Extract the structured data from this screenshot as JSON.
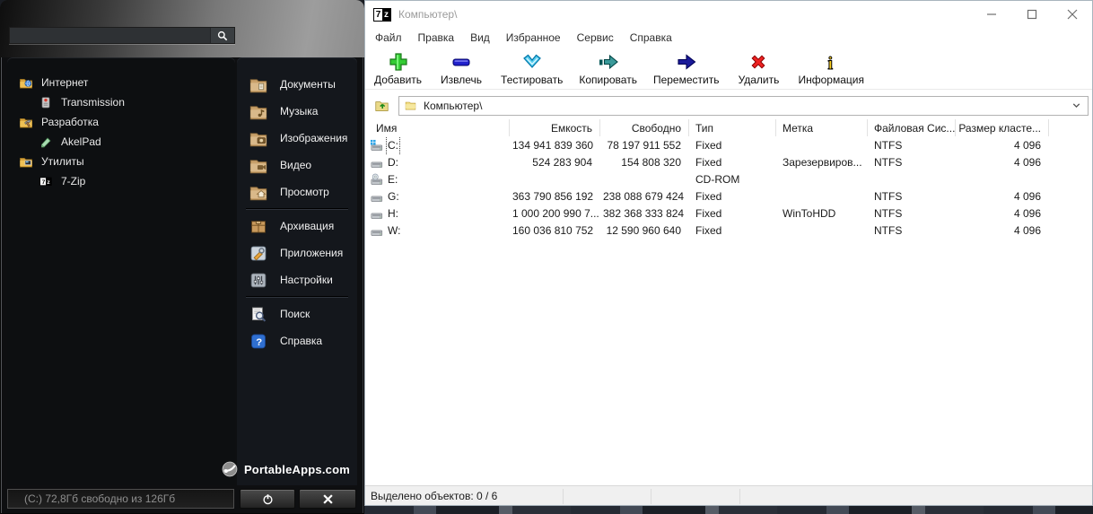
{
  "portableapps": {
    "search": {
      "value": "",
      "placeholder": ""
    },
    "left_items": [
      {
        "label": "Интернет",
        "type": "category",
        "icon": "folder-globe-icon"
      },
      {
        "label": "Transmission",
        "type": "app",
        "icon": "transmission-icon"
      },
      {
        "label": "Разработка",
        "type": "category",
        "icon": "folder-dev-icon"
      },
      {
        "label": "AkelPad",
        "type": "app",
        "icon": "akelpad-icon"
      },
      {
        "label": "Утилиты",
        "type": "category",
        "icon": "folder-utils-icon"
      },
      {
        "label": "7-Zip",
        "type": "app",
        "icon": "sevenzip-app-icon"
      }
    ],
    "right_items": [
      {
        "label": "Документы",
        "icon": "folder-documents-icon"
      },
      {
        "label": "Музыка",
        "icon": "folder-music-icon"
      },
      {
        "label": "Изображения",
        "icon": "folder-pictures-icon"
      },
      {
        "label": "Видео",
        "icon": "folder-video-icon"
      },
      {
        "label": "Просмотр",
        "icon": "folder-explore-icon"
      },
      {
        "divider": true
      },
      {
        "label": "Архивация",
        "icon": "backup-box-icon"
      },
      {
        "label": "Приложения",
        "icon": "apps-tools-icon"
      },
      {
        "label": "Настройки",
        "icon": "options-sliders-icon"
      },
      {
        "divider": true
      },
      {
        "label": "Поиск",
        "icon": "search-doc-icon"
      },
      {
        "label": "Справка",
        "icon": "help-question-icon"
      }
    ],
    "logo_text": "PortableApps.com",
    "statusbar": {
      "drive_space": "(C:) 72,8Гб свободно из 126Гб"
    }
  },
  "sevenzip": {
    "title": "Компьютер\\",
    "menu": [
      "Файл",
      "Правка",
      "Вид",
      "Избранное",
      "Сервис",
      "Справка"
    ],
    "toolbar": [
      {
        "label": "Добавить",
        "icon": "add-plus-icon"
      },
      {
        "label": "Извлечь",
        "icon": "extract-minus-icon"
      },
      {
        "label": "Тестировать",
        "icon": "test-check-icon"
      },
      {
        "label": "Копировать",
        "icon": "copy-arrow-icon"
      },
      {
        "label": "Переместить",
        "icon": "move-arrow-icon"
      },
      {
        "label": "Удалить",
        "icon": "delete-x-icon"
      },
      {
        "label": "Информация",
        "icon": "info-i-icon"
      }
    ],
    "address": {
      "path": "Компьютер\\"
    },
    "table": {
      "columns": [
        "Имя",
        "Емкость",
        "Свободно",
        "Тип",
        "Метка",
        "Файловая Сис...",
        "Размер класте..."
      ],
      "rows": [
        {
          "name": "C:",
          "capacity": "134 941 839 360",
          "free": "78 197 911 552",
          "type": "Fixed",
          "label": "",
          "fs": "NTFS",
          "cluster": "4 096",
          "icon": "drive-system-icon",
          "focused": true
        },
        {
          "name": "D:",
          "capacity": "524 283 904",
          "free": "154 808 320",
          "type": "Fixed",
          "label": "Зарезервиров...",
          "fs": "NTFS",
          "cluster": "4 096",
          "icon": "drive-icon",
          "focused": false
        },
        {
          "name": "E:",
          "capacity": "",
          "free": "",
          "type": "CD-ROM",
          "label": "",
          "fs": "",
          "cluster": "",
          "icon": "drive-cd-icon",
          "focused": false
        },
        {
          "name": "G:",
          "capacity": "363 790 856 192",
          "free": "238 088 679 424",
          "type": "Fixed",
          "label": "",
          "fs": "NTFS",
          "cluster": "4 096",
          "icon": "drive-icon",
          "focused": false
        },
        {
          "name": "H:",
          "capacity": "1 000 200 990 7...",
          "free": "382 368 333 824",
          "type": "Fixed",
          "label": "WinToHDD",
          "fs": "NTFS",
          "cluster": "4 096",
          "icon": "drive-icon",
          "focused": false
        },
        {
          "name": "W:",
          "capacity": "160 036 810 752",
          "free": "12 590 960 640",
          "type": "Fixed",
          "label": "",
          "fs": "NTFS",
          "cluster": "4 096",
          "icon": "drive-icon",
          "focused": false
        }
      ]
    },
    "statusbar": {
      "selected_text": "Выделено объектов: 0 / 6"
    }
  },
  "colors": {
    "pa_panel_dark": "#0d0f11",
    "pa_panel_light": "#14171c",
    "pa_status_text": "#8f8f8f",
    "zip_title_inactive": "#9b9b9b",
    "add_green": "#33cc33",
    "extract_blue": "#2222cc",
    "test_cyan": "#55ccee",
    "copy_teal": "#339999",
    "move_navy": "#111188",
    "delete_red": "#ee2222",
    "info_yellow": "#ffd21e",
    "help_blue": "#2f6fd0",
    "folder_gold": "#d9a33c",
    "folder_tan": "#c8a06a"
  }
}
